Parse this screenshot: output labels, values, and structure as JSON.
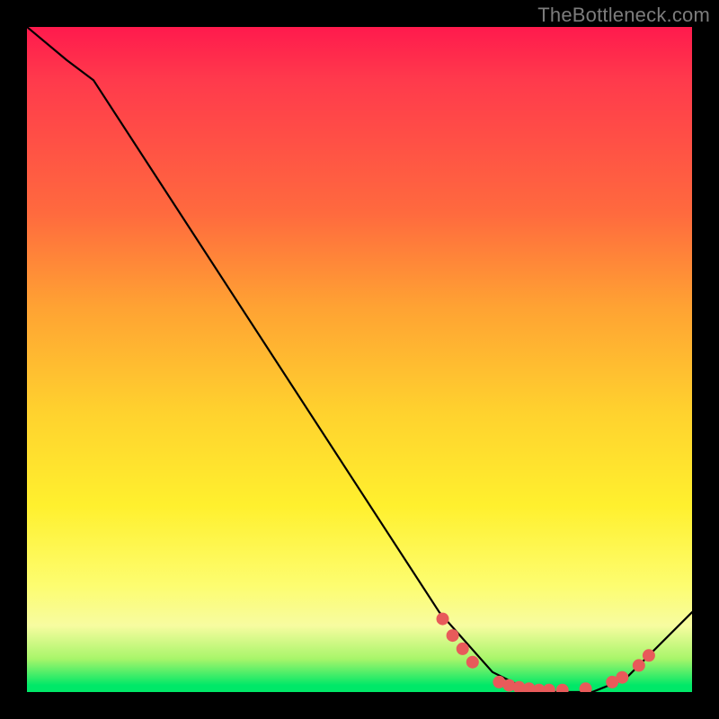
{
  "watermark": "TheBottleneck.com",
  "chart_data": {
    "type": "line",
    "title": "",
    "xlabel": "",
    "ylabel": "",
    "xlim": [
      0,
      100
    ],
    "ylim": [
      0,
      100
    ],
    "series": [
      {
        "name": "curve",
        "color": "#000000",
        "x": [
          0,
          6,
          10,
          62,
          70,
          76,
          85,
          90,
          100
        ],
        "y": [
          100,
          95,
          92,
          12,
          3,
          0,
          0,
          2,
          12
        ]
      }
    ],
    "markers": [
      {
        "name": "dots",
        "color": "#e85a5a",
        "radius": 7,
        "points": [
          {
            "x": 62.5,
            "y": 11
          },
          {
            "x": 64,
            "y": 8.5
          },
          {
            "x": 65.5,
            "y": 6.5
          },
          {
            "x": 67,
            "y": 4.5
          },
          {
            "x": 71,
            "y": 1.5
          },
          {
            "x": 72.5,
            "y": 1
          },
          {
            "x": 74,
            "y": 0.7
          },
          {
            "x": 75.5,
            "y": 0.5
          },
          {
            "x": 77,
            "y": 0.3
          },
          {
            "x": 78.5,
            "y": 0.3
          },
          {
            "x": 80.5,
            "y": 0.3
          },
          {
            "x": 84,
            "y": 0.5
          },
          {
            "x": 88,
            "y": 1.5
          },
          {
            "x": 89.5,
            "y": 2.2
          },
          {
            "x": 92,
            "y": 4
          },
          {
            "x": 93.5,
            "y": 5.5
          }
        ]
      }
    ],
    "gradient_stops": [
      {
        "pos": 0,
        "color": "#ff1a4d"
      },
      {
        "pos": 0.28,
        "color": "#ff6a3e"
      },
      {
        "pos": 0.58,
        "color": "#ffd22e"
      },
      {
        "pos": 0.84,
        "color": "#fdfd70"
      },
      {
        "pos": 0.95,
        "color": "#a8f56a"
      },
      {
        "pos": 1.0,
        "color": "#00e868"
      }
    ]
  }
}
